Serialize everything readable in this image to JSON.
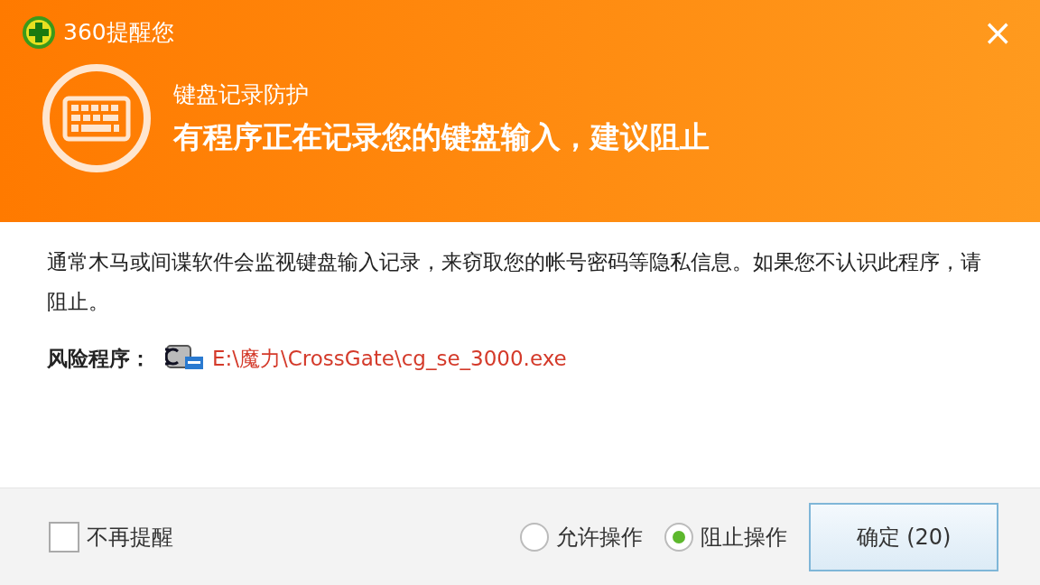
{
  "window": {
    "title": "360提醒您",
    "close": "×"
  },
  "header": {
    "category": "键盘记录防护",
    "headline": "有程序正在记录您的键盘输入，建议阻止"
  },
  "body": {
    "description": "通常木马或间谍软件会监视键盘输入记录，来窃取您的帐号密码等隐私信息。如果您不认识此程序，请阻止。",
    "risk_label": "风险程序：",
    "risk_path": "E:\\魔力\\CrossGate\\cg_se_3000.exe"
  },
  "footer": {
    "dont_remind": {
      "label": "不再提醒",
      "checked": false
    },
    "options": [
      {
        "label": "允许操作",
        "selected": false
      },
      {
        "label": "阻止操作",
        "selected": true
      }
    ],
    "confirm_button": "确定 (20)"
  }
}
